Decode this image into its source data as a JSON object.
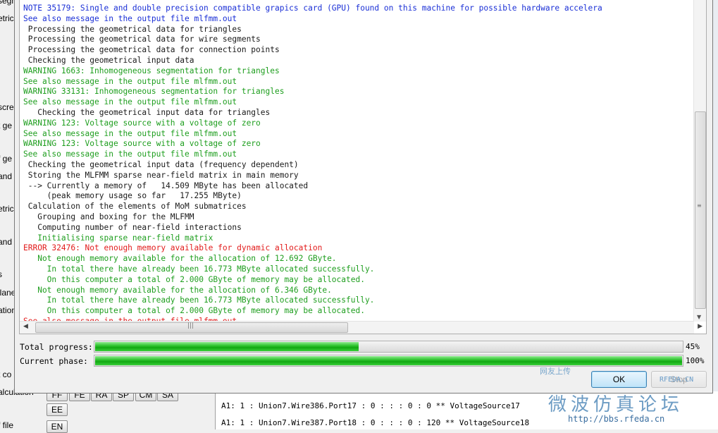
{
  "background_app": {
    "left_fragments": [
      "segm",
      "etric",
      "scre",
      "t ge",
      "f ge",
      "and",
      "etric",
      "and",
      "s",
      "llane",
      "ation"
    ],
    "bottom_fragments": [
      "t co",
      "alculation",
      "f file"
    ],
    "buttons": [
      "FF",
      "FE",
      "RA",
      "SP",
      "CM",
      "SA",
      "EE",
      "EN"
    ],
    "log_lines": [
      "A1: 1 : Union7.Wire386.Port17 : 0 :  :  : 0 : 0 ** VoltageSource17",
      "A1: 1 : Union7.Wire387.Port18 : 0 :  :  : 0 : 120 ** VoltageSource18"
    ]
  },
  "watermark": {
    "text_top": "网友上传",
    "rfeda": "RFEDA.CN",
    "forum_cn": "微波仿真论坛",
    "url": "http://bbs.rfeda.cn"
  },
  "dialog": {
    "log": [
      {
        "text": "NOTE 35179: Single and double precision compatible grapics card (GPU) found on this machine for possible hardware accelera",
        "color": "blue"
      },
      {
        "text": "See also message in the output file mlfmm.out",
        "color": "blue"
      },
      {
        "text": " Processing the geometrical data for triangles",
        "color": "black"
      },
      {
        "text": " Processing the geometrical data for wire segments",
        "color": "black"
      },
      {
        "text": " Processing the geometrical data for connection points",
        "color": "black"
      },
      {
        "text": " Checking the geometrical input data",
        "color": "black"
      },
      {
        "text": "WARNING 1663: Inhomogeneous segmentation for triangles",
        "color": "green"
      },
      {
        "text": "See also message in the output file mlfmm.out",
        "color": "green"
      },
      {
        "text": "WARNING 33131: Inhomogeneous segmentation for triangles",
        "color": "green"
      },
      {
        "text": "See also message in the output file mlfmm.out",
        "color": "green"
      },
      {
        "text": "   Checking the geometrical input data for triangles",
        "color": "black"
      },
      {
        "text": "WARNING 123: Voltage source with a voltage of zero",
        "color": "green"
      },
      {
        "text": "See also message in the output file mlfmm.out",
        "color": "green"
      },
      {
        "text": "WARNING 123: Voltage source with a voltage of zero",
        "color": "green"
      },
      {
        "text": "See also message in the output file mlfmm.out",
        "color": "green"
      },
      {
        "text": " Checking the geometrical input data (frequency dependent)",
        "color": "black"
      },
      {
        "text": " Storing the MLFMM sparse near-field matrix in main memory",
        "color": "black"
      },
      {
        "text": " --> Currently a memory of   14.509 MByte has been allocated",
        "color": "black"
      },
      {
        "text": "     (peak memory usage so far   17.255 MByte)",
        "color": "black"
      },
      {
        "text": " Calculation of the elements of MoM submatrices",
        "color": "black"
      },
      {
        "text": "   Grouping and boxing for the MLFMM",
        "color": "black"
      },
      {
        "text": "   Computing number of near-field interactions",
        "color": "black"
      },
      {
        "text": "   Initialising sparse near-field matrix",
        "color": "green"
      },
      {
        "text": "ERROR 32476: Not enough memory available for dynamic allocation",
        "color": "red"
      },
      {
        "text": "   Not enough memory available for the allocation of 12.692 GByte.",
        "color": "green"
      },
      {
        "text": "     In total there have already been 16.773 MByte allocated successfully.",
        "color": "green"
      },
      {
        "text": "     On this computer a total of 2.000 GByte of memory may be allocated.",
        "color": "green"
      },
      {
        "text": "   Not enough memory available for the allocation of 6.346 GByte.",
        "color": "green"
      },
      {
        "text": "     In total there have already been 16.773 MByte allocated successfully.",
        "color": "green"
      },
      {
        "text": "     On this computer a total of 2.000 GByte of memory may be allocated.",
        "color": "green"
      },
      {
        "text": "See also message in the output file mlfmm.out",
        "color": "red"
      }
    ],
    "total_progress": {
      "label": "Total progress:",
      "value": 45,
      "text": "45%"
    },
    "current_phase": {
      "label": "Current phase:",
      "value": 100,
      "text": "100%"
    },
    "ok_label": "OK",
    "stop_label": "Stop",
    "colors": {
      "blue": "#1a2fd6",
      "black": "#1a1a1a",
      "green": "#1e9e1e",
      "red": "#e21b1b",
      "progress": "#12a812"
    }
  }
}
